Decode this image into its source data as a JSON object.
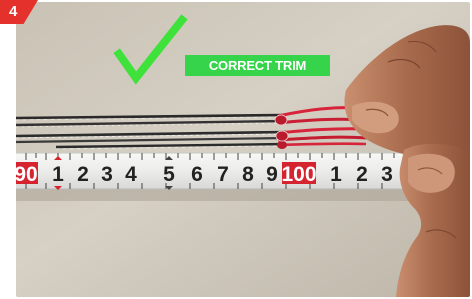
{
  "step_number": "4",
  "label_text": "CORRECT TRIM",
  "icon": "check-mark-icon",
  "colors": {
    "step_badge": "#e5312b",
    "label_background": "#35d44a",
    "check_mark": "#3fe23b",
    "lines": "#2b2b2b",
    "red_cord": "#d8243a",
    "tape_face": "#ededed",
    "tape_highlight": "#d62330"
  },
  "tape_measure": {
    "marks": [
      "90",
      "1",
      "2",
      "3",
      "4",
      "5",
      "6",
      "7",
      "8",
      "9",
      "100",
      "1",
      "2",
      "3"
    ],
    "highlighted_marks": [
      "90",
      "100"
    ]
  }
}
